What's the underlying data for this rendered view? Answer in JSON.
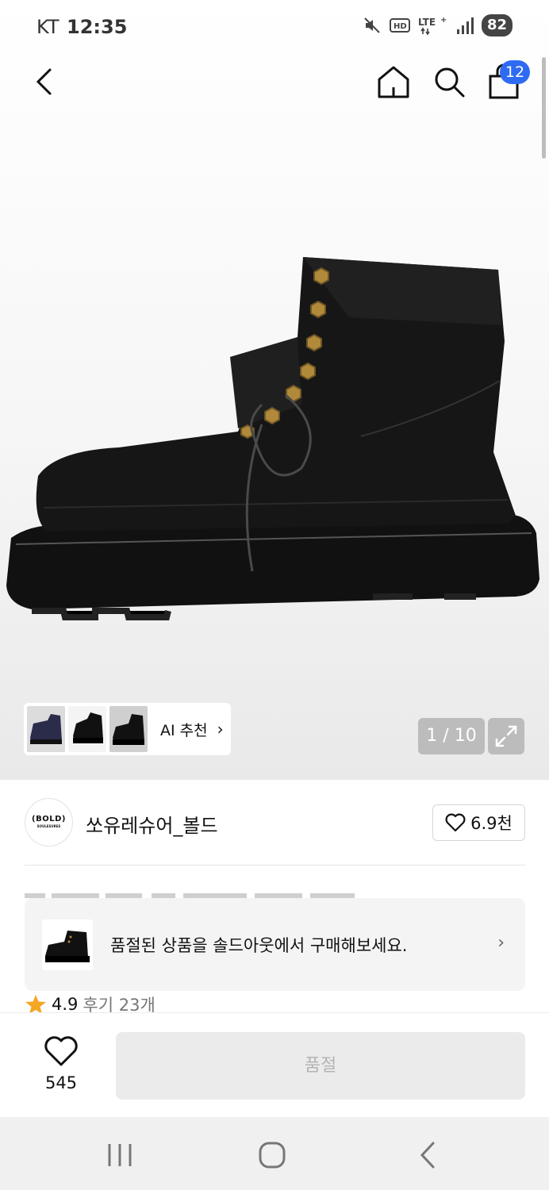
{
  "status_bar": {
    "carrier": "KT",
    "time": "12:35",
    "battery": "82"
  },
  "top_bar": {
    "cart_count": "12"
  },
  "gallery": {
    "ai_label": "AI 추천",
    "pager": "1 / 10"
  },
  "brand": {
    "logo_line1": "(BOLD)",
    "logo_line2": "SOULESURES",
    "name": "쏘유레슈어_볼드",
    "likes": "6.9천"
  },
  "soldout_banner": {
    "text": "품절된 상품을 솔드아웃에서 구매해보세요."
  },
  "rating": {
    "score": "4.9",
    "reviews": "후기 23개"
  },
  "action_bar": {
    "like_count": "545",
    "buy_label": "품절"
  },
  "colors": {
    "badge": "#2f6bf2",
    "star": "#f5a623",
    "buy_bg": "#ebebeb",
    "buy_text": "#b4b4b4"
  },
  "icons": [
    "back-arrow-icon",
    "home-icon",
    "search-icon",
    "shopping-bag-icon",
    "expand-icon",
    "heart-icon",
    "star-icon",
    "chevron-right-icon",
    "mute-icon",
    "hd-icon",
    "lte-icon",
    "signal-icon"
  ]
}
